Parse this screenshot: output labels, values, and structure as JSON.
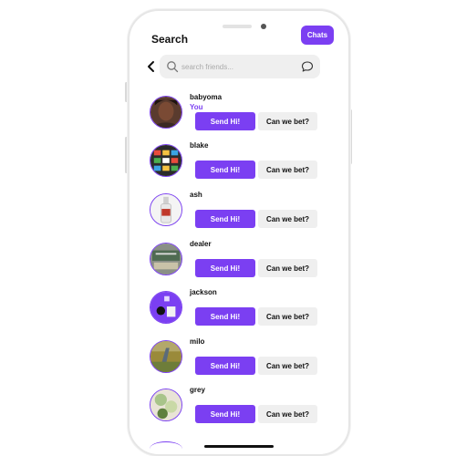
{
  "header": {
    "title": "Search",
    "chats_label": "Chats"
  },
  "search": {
    "placeholder": "search friends..."
  },
  "icons": {
    "back": "chevron-left-icon",
    "search": "search-icon",
    "chat": "chat-bubble-icon"
  },
  "colors": {
    "accent": "#7b3ff2",
    "button_secondary": "#efefef"
  },
  "users": [
    {
      "name": "babyoma",
      "tag": "You",
      "send_label": "Send Hi!",
      "bet_label": "Can we bet?"
    },
    {
      "name": "blake",
      "tag": "",
      "send_label": "Send Hi!",
      "bet_label": "Can we bet?"
    },
    {
      "name": "ash",
      "tag": "",
      "send_label": "Send Hi!",
      "bet_label": "Can we bet?"
    },
    {
      "name": "dealer",
      "tag": "",
      "send_label": "Send Hi!",
      "bet_label": "Can we bet?"
    },
    {
      "name": "jackson",
      "tag": "",
      "send_label": "Send Hi!",
      "bet_label": "Can we bet?"
    },
    {
      "name": "milo",
      "tag": "",
      "send_label": "Send Hi!",
      "bet_label": "Can we bet?"
    },
    {
      "name": "grey",
      "tag": "",
      "send_label": "Send Hi!",
      "bet_label": "Can we bet?"
    }
  ]
}
